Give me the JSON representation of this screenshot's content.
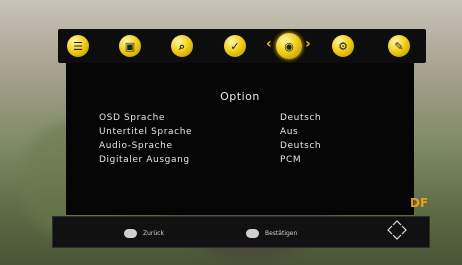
{
  "menu": {
    "icons": [
      "info-icon",
      "picture-icon",
      "search-icon",
      "clock-icon",
      "globe-icon",
      "gear-icon",
      "tools-icon"
    ],
    "selected": "globe-icon"
  },
  "panel": {
    "title": "Option",
    "rows": [
      {
        "label": "OSD Sprache",
        "value": "Deutsch"
      },
      {
        "label": "Untertitel Sprache",
        "value": "Aus"
      },
      {
        "label": "Audio-Sprache",
        "value": "Deutsch"
      },
      {
        "label": "Digitaler Ausgang",
        "value": "PCM"
      }
    ]
  },
  "footer": {
    "back_key": "EXIT",
    "back_label": "Zurück",
    "ok_key": "OK",
    "ok_label": "Bestätigen"
  },
  "colors": {
    "accent": "#f2d11a",
    "panel": "#050505"
  }
}
